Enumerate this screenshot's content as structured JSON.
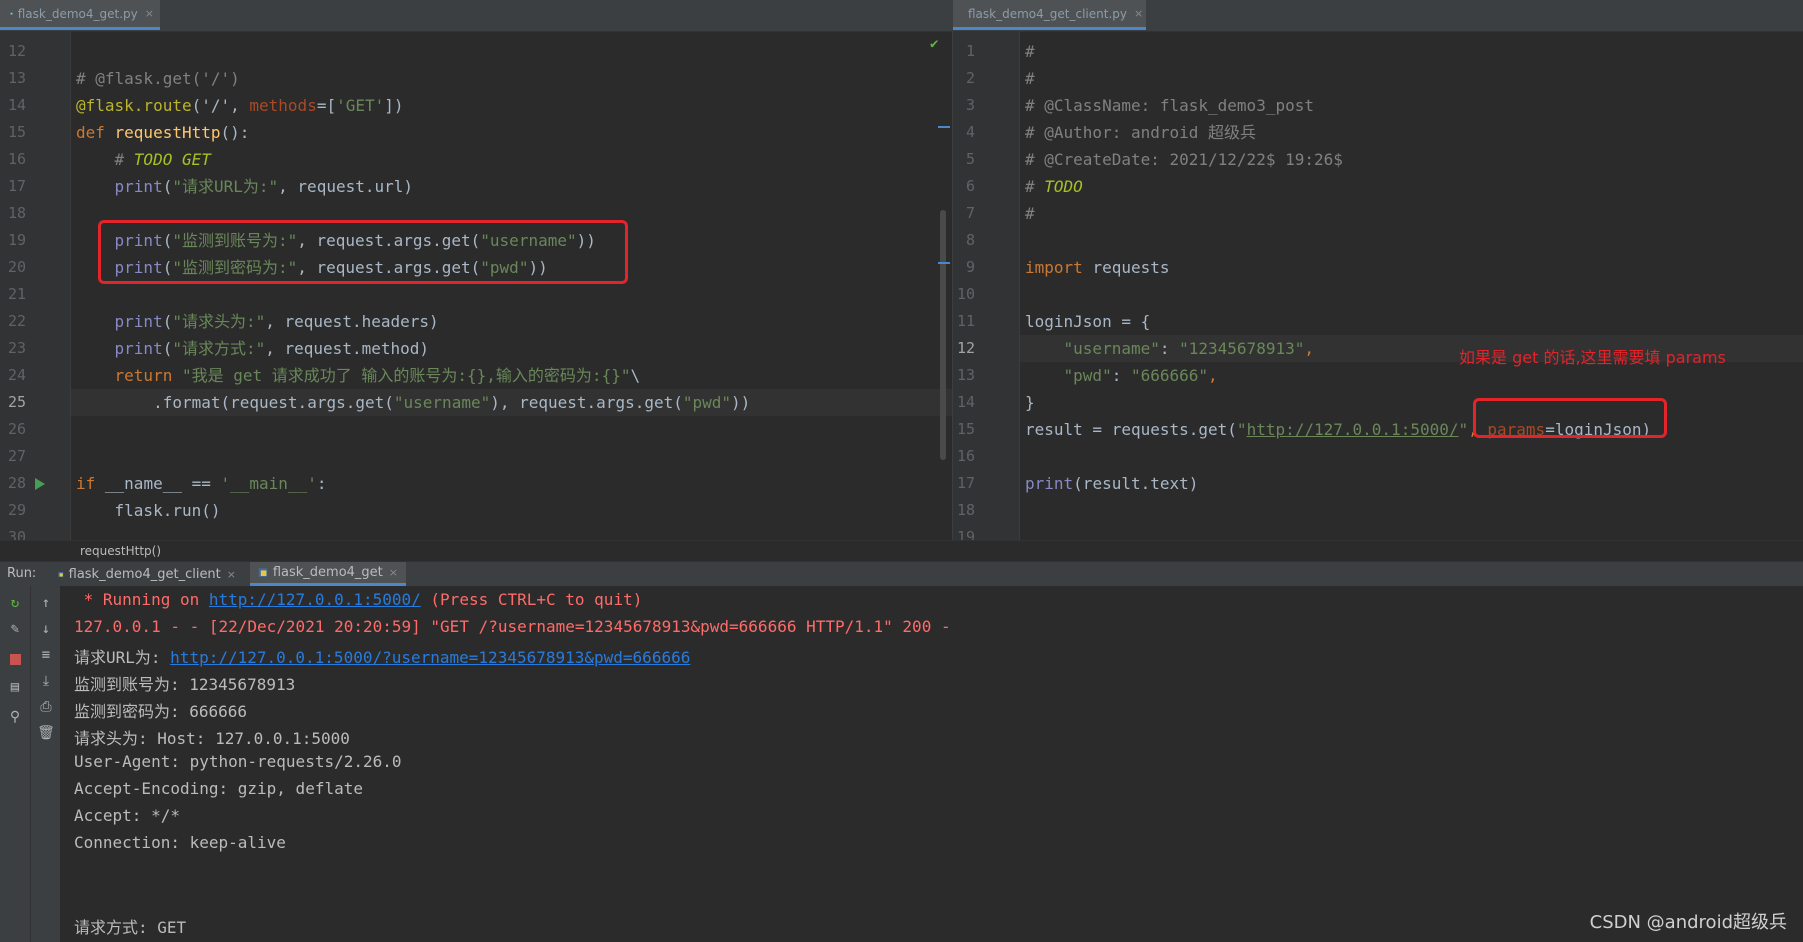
{
  "left_editor": {
    "tab_title": "flask_demo4_get.py",
    "line_numbers": [
      "12",
      "13",
      "14",
      "15",
      "16",
      "17",
      "18",
      "19",
      "20",
      "21",
      "22",
      "23",
      "24",
      "25",
      "26",
      "27",
      "28",
      "29",
      "30"
    ],
    "current_line": "25",
    "lines": [
      [],
      [
        {
          "t": "# @flask.get('/')",
          "c": "c"
        }
      ],
      [
        {
          "t": "@flask.route",
          "c": "d"
        },
        {
          "t": "('/', ",
          "c": "s0"
        },
        {
          "t": "methods",
          "c": "pm"
        },
        {
          "t": "=[",
          "c": ""
        },
        {
          "t": "'GET'",
          "c": "s"
        },
        {
          "t": "])",
          "c": ""
        }
      ],
      [
        {
          "t": "def ",
          "c": "k"
        },
        {
          "t": "requestHttp",
          "c": "f"
        },
        {
          "t": "():",
          "c": ""
        }
      ],
      [
        {
          "t": "    # ",
          "c": "c"
        },
        {
          "t": "TODO GET",
          "c": "t"
        }
      ],
      [
        {
          "t": "    ",
          "c": ""
        },
        {
          "t": "print",
          "c": "bi"
        },
        {
          "t": "(",
          "c": ""
        },
        {
          "t": "\"请求URL为:\"",
          "c": "s"
        },
        {
          "t": ", request.url)",
          "c": ""
        }
      ],
      [],
      [
        {
          "t": "    ",
          "c": ""
        },
        {
          "t": "print",
          "c": "bi"
        },
        {
          "t": "(",
          "c": ""
        },
        {
          "t": "\"监测到账号为:\"",
          "c": "s"
        },
        {
          "t": ", request.args.get(",
          "c": ""
        },
        {
          "t": "\"username\"",
          "c": "s"
        },
        {
          "t": "))",
          "c": ""
        }
      ],
      [
        {
          "t": "    ",
          "c": ""
        },
        {
          "t": "print",
          "c": "bi"
        },
        {
          "t": "(",
          "c": ""
        },
        {
          "t": "\"监测到密码为:\"",
          "c": "s"
        },
        {
          "t": ", request.args.get(",
          "c": ""
        },
        {
          "t": "\"pwd\"",
          "c": "s"
        },
        {
          "t": "))",
          "c": ""
        }
      ],
      [],
      [
        {
          "t": "    ",
          "c": ""
        },
        {
          "t": "print",
          "c": "bi"
        },
        {
          "t": "(",
          "c": ""
        },
        {
          "t": "\"请求头为:\"",
          "c": "s"
        },
        {
          "t": ", request.headers)",
          "c": ""
        }
      ],
      [
        {
          "t": "    ",
          "c": ""
        },
        {
          "t": "print",
          "c": "bi"
        },
        {
          "t": "(",
          "c": ""
        },
        {
          "t": "\"请求方式:\"",
          "c": "s"
        },
        {
          "t": ", request.method)",
          "c": ""
        }
      ],
      [
        {
          "t": "    ",
          "c": ""
        },
        {
          "t": "return ",
          "c": "k"
        },
        {
          "t": "\"我是 get 请求成功了 输入的账号为:{},输入的密码为:{}\"",
          "c": "s"
        },
        {
          "t": "\\",
          "c": ""
        }
      ],
      [
        {
          "t": "        .format(request.args.get(",
          "c": ""
        },
        {
          "t": "\"username\"",
          "c": "s"
        },
        {
          "t": "), request.args.get(",
          "c": ""
        },
        {
          "t": "\"pwd\"",
          "c": "s"
        },
        {
          "t": "))",
          "c": ""
        }
      ],
      [],
      [],
      [
        {
          "t": "if ",
          "c": "k"
        },
        {
          "t": "__name__ == ",
          "c": ""
        },
        {
          "t": "'__main__'",
          "c": "s"
        },
        {
          "t": ":",
          "c": ""
        }
      ],
      [
        {
          "t": "    flask.run()",
          "c": ""
        }
      ],
      []
    ]
  },
  "right_editor": {
    "tab_title": "flask_demo4_get_client.py",
    "line_numbers": [
      "1",
      "2",
      "3",
      "4",
      "5",
      "6",
      "7",
      "8",
      "9",
      "10",
      "11",
      "12",
      "13",
      "14",
      "15",
      "16",
      "17",
      "18",
      "19"
    ],
    "current_line": "12",
    "lines": [
      [
        {
          "t": "#",
          "c": "c"
        }
      ],
      [
        {
          "t": "#",
          "c": "c"
        }
      ],
      [
        {
          "t": "# @ClassName: flask_demo3_post",
          "c": "c"
        }
      ],
      [
        {
          "t": "# @Author: android 超级兵",
          "c": "c"
        }
      ],
      [
        {
          "t": "# @CreateDate: 2021/12/22$ 19:26$",
          "c": "c"
        }
      ],
      [
        {
          "t": "# ",
          "c": "c"
        },
        {
          "t": "TODO",
          "c": "t"
        }
      ],
      [
        {
          "t": "#",
          "c": "c"
        }
      ],
      [],
      [
        {
          "t": "import ",
          "c": "k"
        },
        {
          "t": "requests",
          "c": ""
        }
      ],
      [],
      [
        {
          "t": "loginJson = {",
          "c": ""
        }
      ],
      [
        {
          "t": "    ",
          "c": ""
        },
        {
          "t": "\"username\"",
          "c": "s"
        },
        {
          "t": ": ",
          "c": ""
        },
        {
          "t": "\"12345678913\"",
          "c": "s"
        },
        {
          "t": ",",
          "c": "k"
        }
      ],
      [
        {
          "t": "    ",
          "c": ""
        },
        {
          "t": "\"pwd\"",
          "c": "s"
        },
        {
          "t": ": ",
          "c": ""
        },
        {
          "t": "\"666666\"",
          "c": "s"
        },
        {
          "t": ",",
          "c": "k"
        }
      ],
      [
        {
          "t": "}",
          "c": ""
        }
      ],
      [
        {
          "t": "result = requests.get(",
          "c": ""
        },
        {
          "t": "\"",
          "c": "s"
        },
        {
          "t": "http://127.0.0.1:5000/",
          "c": "su"
        },
        {
          "t": "\"",
          "c": "s"
        },
        {
          "t": ", ",
          "c": "k"
        },
        {
          "t": "params",
          "c": "pm"
        },
        {
          "t": "=loginJson)",
          "c": ""
        }
      ],
      [],
      [
        {
          "t": "print",
          "c": "bi"
        },
        {
          "t": "(result.text)",
          "c": ""
        }
      ],
      [],
      []
    ],
    "annotation": "如果是 get 的话,这里需要填 params"
  },
  "breadcrumb": "requestHttp()",
  "run": {
    "label": "Run:",
    "tabs": [
      "flask_demo4_get_client",
      "flask_demo4_get"
    ],
    "active_tab": 1
  },
  "console": {
    "lines": [
      [
        {
          "t": " * Running on ",
          "c": "err"
        },
        {
          "t": "http://127.0.0.1:5000/",
          "c": "u"
        },
        {
          "t": " (Press CTRL+C to quit)",
          "c": "err"
        }
      ],
      [
        {
          "t": "127.0.0.1 - - [22/Dec/2021 20:20:59] \"GET /?username=12345678913&pwd=666666 HTTP/1.1\" 200 -",
          "c": "err"
        }
      ],
      [
        {
          "t": "请求URL为: ",
          "c": ""
        },
        {
          "t": "http://127.0.0.1:5000/?username=12345678913&pwd=666666",
          "c": "u"
        }
      ],
      [
        {
          "t": "监测到账号为: 12345678913",
          "c": ""
        }
      ],
      [
        {
          "t": "监测到密码为: 666666",
          "c": ""
        }
      ],
      [
        {
          "t": "请求头为: Host: 127.0.0.1:5000",
          "c": ""
        }
      ],
      [
        {
          "t": "User-Agent: python-requests/2.26.0",
          "c": ""
        }
      ],
      [
        {
          "t": "Accept-Encoding: gzip, deflate",
          "c": ""
        }
      ],
      [
        {
          "t": "Accept: */*",
          "c": ""
        }
      ],
      [
        {
          "t": "Connection: keep-alive",
          "c": ""
        }
      ],
      [],
      [],
      [
        {
          "t": "请求方式: GET",
          "c": ""
        }
      ]
    ]
  },
  "watermark": "CSDN @android超级兵",
  "icons": {
    "file": "python-file-icon",
    "close": "×",
    "run": "run-triangle-icon",
    "check": "✔"
  },
  "colors": {
    "highlight_box": "#e3242b",
    "accent": "#4a88c7"
  }
}
